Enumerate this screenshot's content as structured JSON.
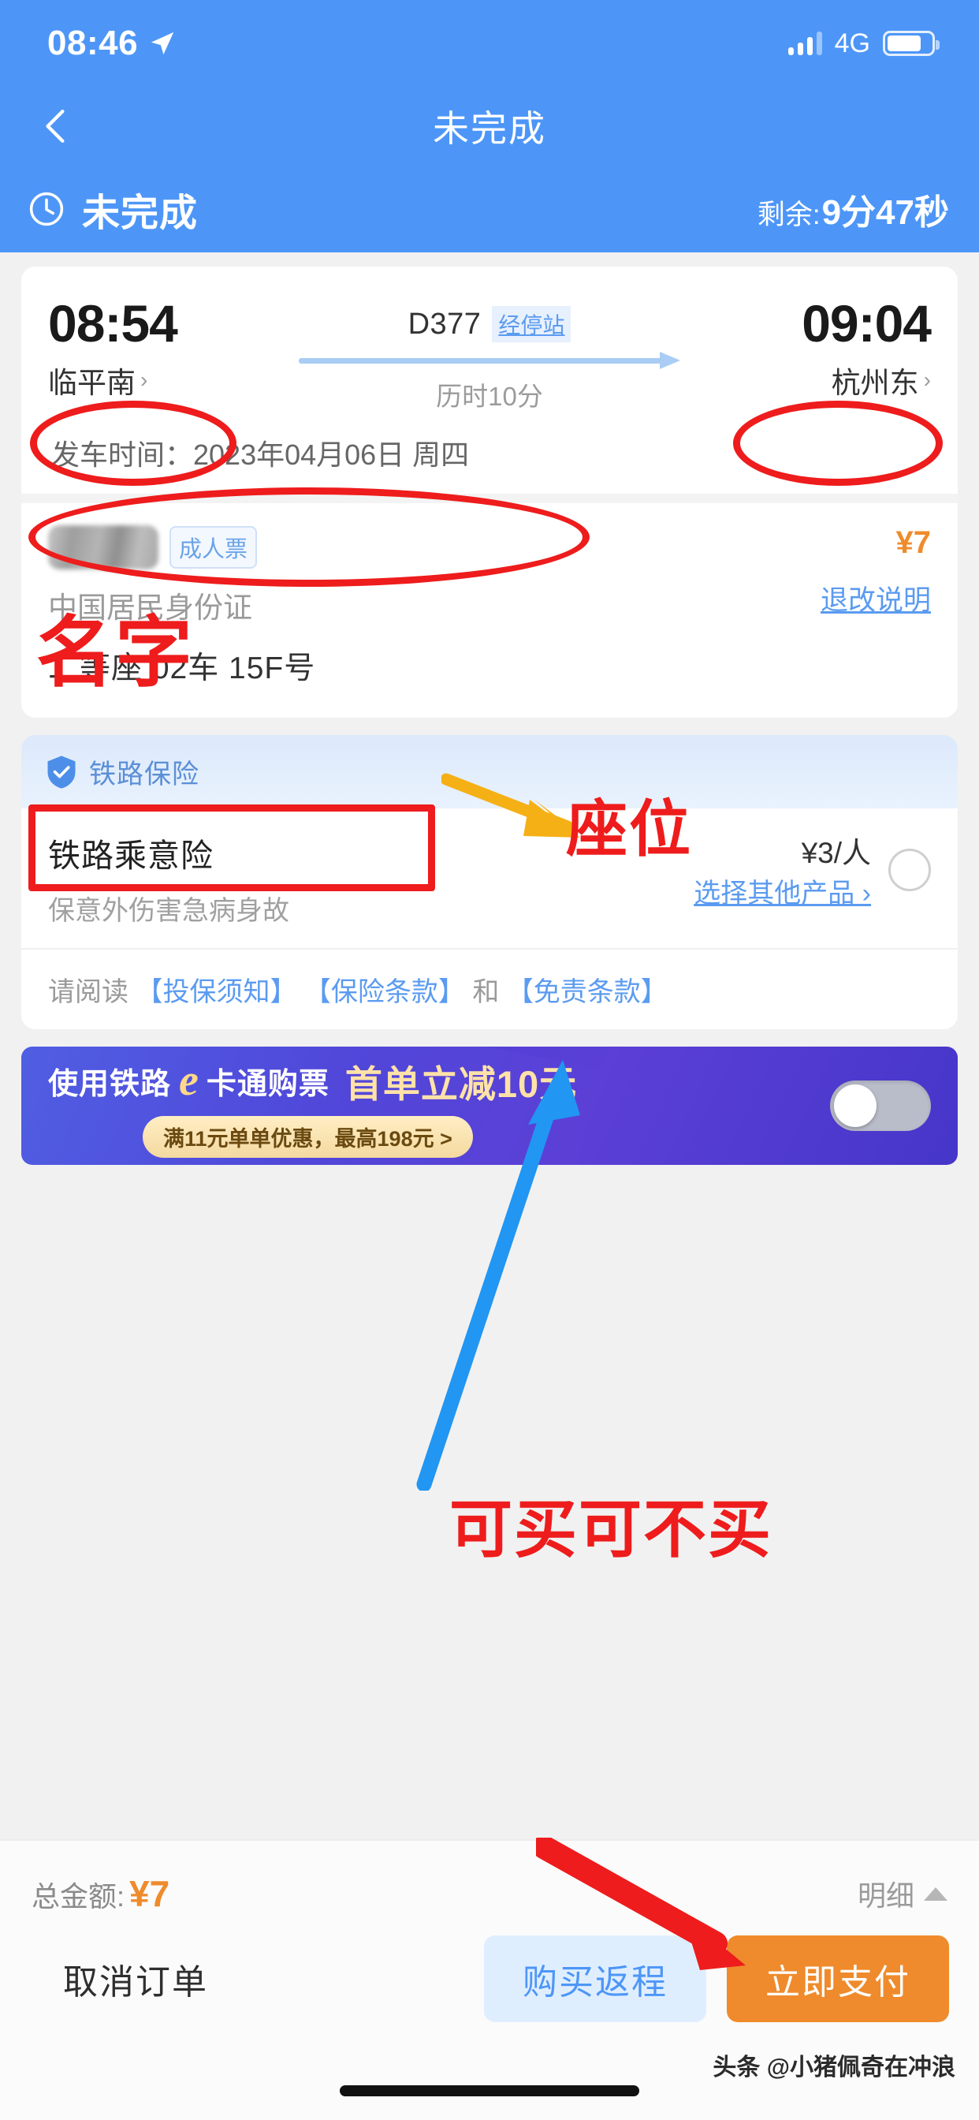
{
  "statusbar": {
    "time": "08:46",
    "network": "4G",
    "icons": [
      "location-arrow-icon",
      "signal-bars-icon",
      "battery-icon"
    ]
  },
  "navbar": {
    "title": "未完成",
    "back_icon": "chevron-left-icon"
  },
  "order_status": {
    "clock_icon": "clock-icon",
    "label": "未完成",
    "remaining_prefix": "剩余:",
    "remaining_value": "9分47秒"
  },
  "trip": {
    "depart_time": "08:54",
    "depart_station": "临平南",
    "arrive_time": "09:04",
    "arrive_station": "杭州东",
    "train_no": "D377",
    "stops_link": "经停站",
    "duration": "历时10分",
    "depart_date": "发车时间：2023年04月06日 周四",
    "chevron": "›"
  },
  "passenger": {
    "name_masked": "",
    "ticket_type_tag": "成人票",
    "id_type": "中国居民身份证",
    "seat": "二等座 02车 15F号",
    "price": "¥7",
    "refund_policy": "退改说明"
  },
  "insurance": {
    "header": "铁路保险",
    "shield_icon": "shield-check-icon",
    "product_name": "铁路乘意险",
    "product_desc": "保意外伤害急病身故",
    "price": "¥3/人",
    "other_products": "选择其他产品 ›",
    "selected": false,
    "terms_prefix": "请阅读",
    "terms_links": [
      "【投保须知】",
      "【保险条款】",
      "【免责条款】"
    ],
    "terms_and": "和"
  },
  "promo": {
    "text_before": "使用铁路",
    "logo_letter": "e",
    "text_after": "卡通购票",
    "highlight": "首单立减10元",
    "pill": "满11元单单优惠，最高198元 >",
    "toggle_on": false
  },
  "bottom": {
    "total_label": "总金额:",
    "total_amount": "¥7",
    "detail_label": "明细",
    "detail_caret": "caret-up-icon",
    "cancel_button": "取消订单",
    "return_button": "购买返程",
    "pay_button": "立即支付"
  },
  "watermark": "头条 @小猪佩奇在冲浪",
  "annotations": {
    "name_label": "名字",
    "seat_label": "座位",
    "insurance_label": "可买可不买"
  },
  "colors": {
    "brand_blue": "#4d96f7",
    "accent_orange": "#ef8b2c",
    "link_blue": "#5b9bf0",
    "annotation_red": "#ee1c1c",
    "annotation_yellow": "#f5b016",
    "annotation_blue": "#2196f3",
    "promo_purple": "#4a3fd8"
  }
}
